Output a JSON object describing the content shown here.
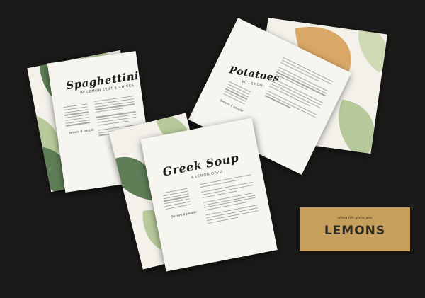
{
  "cards": {
    "spaghettini": {
      "title": "Spaghettini",
      "subtitle": "W/ LEMON ZEST & CHIVES",
      "serves": "Serves 4 people"
    },
    "potatoes": {
      "title": "Potatoes",
      "subtitle": "W/ LEMON",
      "serves": "Serves 4 people"
    },
    "greek_soup": {
      "title": "Greek Soup",
      "subtitle": "& LEMON ORZO",
      "serves": "Serves 4 people"
    }
  },
  "banner": {
    "tagline": "when life gives you",
    "word": "LEMONS"
  },
  "colors": {
    "background": "#1b1a19",
    "card": "#f7f5ef",
    "leaf_dark": "#5f7e57",
    "leaf_light": "#b7c99a",
    "lemon": "#d9a866",
    "banner": "#c79f5d"
  }
}
